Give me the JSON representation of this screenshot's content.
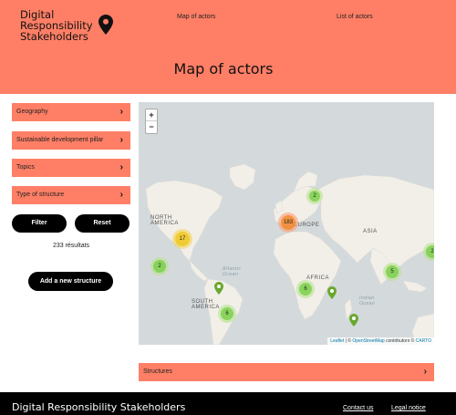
{
  "header": {
    "brand_lines": [
      "Digital",
      "Responsibility",
      "Stakeholders"
    ],
    "logo_icon": "map-pin-icon",
    "nav": [
      {
        "label": "Map of actors"
      },
      {
        "label": "List of actors"
      }
    ],
    "page_title": "Map of actors"
  },
  "filters": {
    "items": [
      {
        "label": "Geography",
        "icon": "chevron-right-icon"
      },
      {
        "label": "Sustainable development pillar",
        "icon": "chevron-right-icon"
      },
      {
        "label": "Topics",
        "icon": "chevron-right-icon"
      },
      {
        "label": "Type of structure",
        "icon": "chevron-right-icon"
      }
    ],
    "filter_button": "Filter",
    "reset_button": "Reset",
    "results_text": "233 résultats",
    "add_button": "Add a new structure"
  },
  "map": {
    "zoom_in": "+",
    "zoom_out": "−",
    "region_labels": {
      "north_america": [
        "NORTH",
        "AMERICA"
      ],
      "south_america": [
        "SOUTH",
        "AMERICA"
      ],
      "europe": "EUROPE",
      "africa": "AFRICA",
      "asia": "ASIA",
      "atlantic": [
        "Atlantic",
        "Ocean"
      ],
      "indian": [
        "Indian",
        "Ocean"
      ]
    },
    "clusters": [
      {
        "count": "2",
        "level": "green"
      },
      {
        "count": "183",
        "level": "orange"
      },
      {
        "count": "17",
        "level": "yellow"
      },
      {
        "count": "2",
        "level": "green"
      },
      {
        "count": "5",
        "level": "green"
      },
      {
        "count": "6",
        "level": "green"
      },
      {
        "count": "6",
        "level": "green"
      },
      {
        "count": "2",
        "level": "green"
      }
    ],
    "attribution": {
      "leaflet": "Leaflet",
      "separator": " | © ",
      "osm": "OpenStreetMap",
      "contributors": " contributors © ",
      "carto": "CARTO"
    },
    "colors": {
      "cluster_green": "#6ecc39",
      "cluster_yellow": "#f0c20c",
      "cluster_orange": "#f18017",
      "marker": "#6aa82e"
    }
  },
  "structures_panel": {
    "label": "Structures",
    "icon": "chevron-right-icon"
  },
  "footer": {
    "brand": "Digital Responsibility Stakeholders",
    "links": [
      {
        "label": "Contact us"
      },
      {
        "label": "Legal notice"
      }
    ]
  },
  "theme": {
    "accent": "#ff7f66",
    "dark": "#000000"
  }
}
